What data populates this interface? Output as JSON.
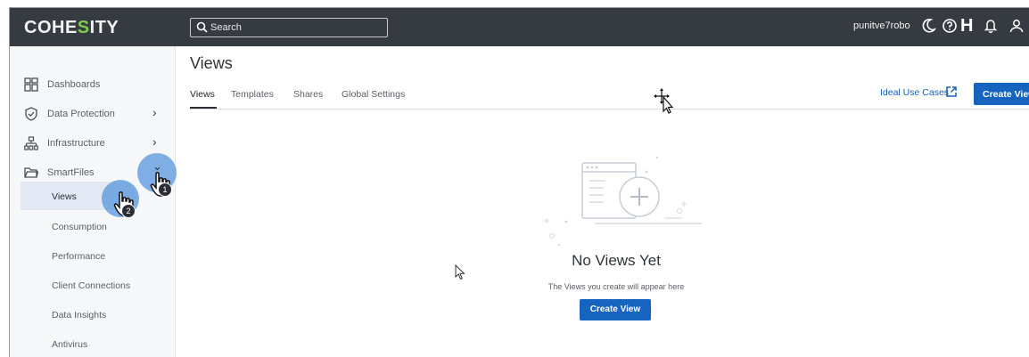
{
  "header": {
    "logo_prefix": "COHE",
    "logo_s": "S",
    "logo_suffix": "ITY",
    "search_placeholder": "Search",
    "username": "punitve7robo"
  },
  "sidebar": {
    "items": [
      {
        "label": "Dashboards",
        "icon": "dashboard-icon"
      },
      {
        "label": "Data Protection",
        "icon": "shield-check-icon"
      },
      {
        "label": "Infrastructure",
        "icon": "infrastructure-icon"
      },
      {
        "label": "SmartFiles",
        "icon": "folder-icon"
      }
    ],
    "smartfiles_sub": [
      "Views",
      "Consumption",
      "Performance",
      "Client Connections",
      "Data Insights",
      "Antivirus"
    ]
  },
  "main": {
    "title": "Views",
    "tabs": [
      "Views",
      "Templates",
      "Shares",
      "Global Settings"
    ],
    "ideal_use_cases": "Ideal Use Cases",
    "create_view_top": "Create View",
    "empty_title": "No Views Yet",
    "empty_subtitle": "The Views you create will appear here",
    "create_view_button": "Create View"
  },
  "annotations": {
    "step1": "1",
    "step2": "2"
  },
  "colors": {
    "topbar": "#363b41",
    "accent": "#1664c0",
    "logo_s": "#7ecb4e",
    "annotation_circle": "#5696dc"
  }
}
